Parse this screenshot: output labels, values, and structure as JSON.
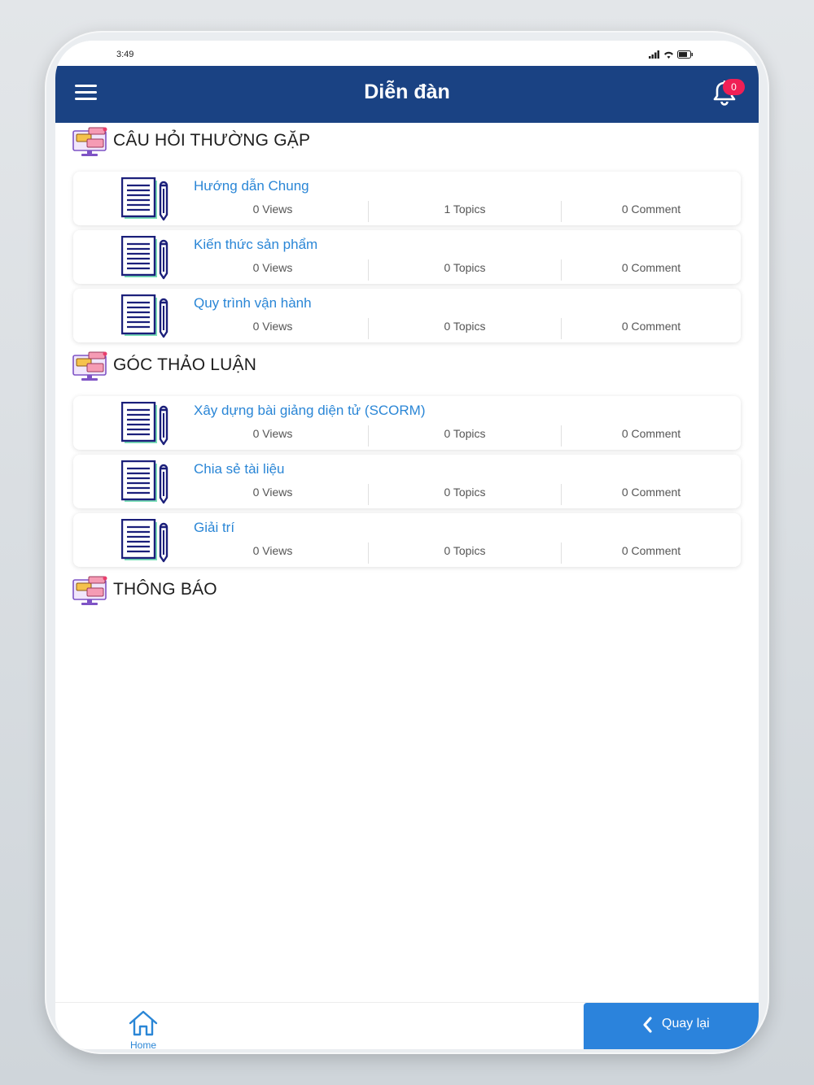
{
  "status_bar": {
    "time": "3:49"
  },
  "header": {
    "title": "Diễn đàn",
    "notification_count": "0"
  },
  "sections": [
    {
      "title": "CÂU HỎI THƯỜNG GẶP",
      "items": [
        {
          "title": "Hướng dẫn Chung",
          "views": "0 Views",
          "topics": "1 Topics",
          "comments": "0 Comment"
        },
        {
          "title": "Kiến thức sản phẩm",
          "views": "0 Views",
          "topics": "0 Topics",
          "comments": "0 Comment"
        },
        {
          "title": "Quy trình vận hành",
          "views": "0 Views",
          "topics": "0 Topics",
          "comments": "0 Comment"
        }
      ]
    },
    {
      "title": "GÓC THẢO LUẬN",
      "items": [
        {
          "title": "Xây dựng bài giảng diện tử (SCORM)",
          "views": "0 Views",
          "topics": "0 Topics",
          "comments": "0 Comment"
        },
        {
          "title": "Chia sẻ tài liệu",
          "views": "0 Views",
          "topics": "0 Topics",
          "comments": "0 Comment"
        },
        {
          "title": "Giải trí",
          "views": "0 Views",
          "topics": "0 Topics",
          "comments": "0 Comment"
        }
      ]
    },
    {
      "title": "THÔNG BÁO",
      "items": []
    }
  ],
  "footer": {
    "home_label": "Home",
    "back_label": "Quay lại"
  },
  "colors": {
    "header": "#1a4283",
    "link": "#2a86d6",
    "badge": "#f01f55",
    "back_button": "#2b83dc"
  },
  "icons": {
    "menu": "hamburger-menu-icon",
    "notification": "bell-icon",
    "section": "forum-monitor-icon",
    "item": "document-pencil-icon",
    "home": "home-icon",
    "back": "chevron-left-icon"
  }
}
